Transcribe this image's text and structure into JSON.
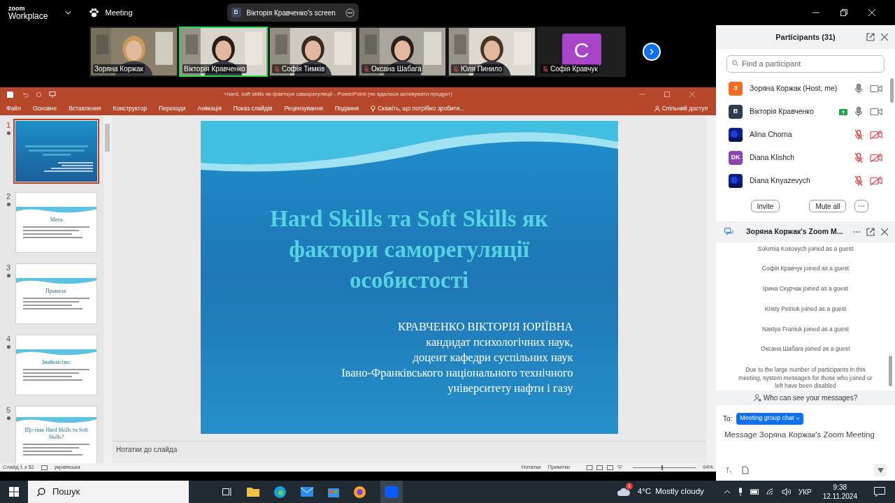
{
  "zoom_bar": {
    "logo_top": "zoom",
    "logo_bottom": "Workplace",
    "meeting": "Meeting",
    "screen_initial": "B",
    "screen_label": "Вікторія Кравченко's screen"
  },
  "videos": [
    {
      "kind": "video",
      "name": "Зоряна Коржак",
      "muted": false,
      "selected": false
    },
    {
      "kind": "video",
      "name": "Вікторія Кравченко",
      "muted": false,
      "selected": true
    },
    {
      "kind": "video",
      "name": "Софія Тимків",
      "muted": true,
      "selected": false
    },
    {
      "kind": "video",
      "name": "Оксана Шабага",
      "muted": true,
      "selected": false
    },
    {
      "kind": "video",
      "name": "Юля Пинило",
      "muted": true,
      "selected": false
    },
    {
      "kind": "avatar",
      "name": "Софія Кравчук",
      "muted": true,
      "selected": false,
      "initial": "C",
      "color": "#a845c9"
    }
  ],
  "powerpoint": {
    "title": "+hard, soft skills як фактори саморегуляції - PowerPoint (не вдалося активувати продукт)",
    "menu": [
      "Файл",
      "Основне",
      "Вставлення",
      "Конструктор",
      "Переходи",
      "Анімація",
      "Показ слайдів",
      "Рецензування",
      "Подання"
    ],
    "tell_me": "Скажіть, що потрібно зробити...",
    "share": "Спільний доступ",
    "thumbnails": [
      {
        "number": "1",
        "kind": "title",
        "selected": true
      },
      {
        "number": "2",
        "kind": "text",
        "selected": false,
        "heading": "Мета"
      },
      {
        "number": "3",
        "kind": "text",
        "selected": false,
        "heading": "Правила:"
      },
      {
        "number": "4",
        "kind": "text",
        "selected": false,
        "heading": "Знайомство:"
      },
      {
        "number": "5",
        "kind": "text",
        "selected": false,
        "heading": "Що таке Hard Skills та Soft Skills?"
      }
    ],
    "slide": {
      "title": "Hard Skills та Soft Skills як фактори саморегуляції особистості",
      "author_lines": [
        "КРАВЧЕНКО ВІКТОРІЯ ЮРІЇВНА",
        "кандидат психологічних наук,",
        "доцент кафедри суспільних наук",
        "Івано-Франківського національного технічного",
        "університету нафти і газу"
      ]
    },
    "notes": "Нотатки до слайда",
    "status": {
      "slide_count": "Слайд 1 з 52",
      "language": "українська",
      "notes_button": "Нотатки",
      "comments_button": "Примітки",
      "zoom": "94%",
      "level": 0.47
    }
  },
  "participants": {
    "title": "Participants (31)",
    "search_placeholder": "Find a participant",
    "people": [
      {
        "kind": "initial",
        "initial": "З",
        "color": "#f26d21",
        "name": "Зоряна Коржак (Host, me)",
        "muted": false,
        "video_off": false,
        "sharing": false
      },
      {
        "kind": "initial",
        "initial": "B",
        "color": "#2d3e50",
        "name": "Вікторія Кравченко",
        "muted": false,
        "video_off": false,
        "sharing": true
      },
      {
        "kind": "picture",
        "name": "Alina Chorna",
        "muted": true,
        "video_off": true,
        "sharing": false
      },
      {
        "kind": "initial",
        "initial": "DK",
        "color": "#8e44ad",
        "name": "Diana Klishch",
        "muted": true,
        "video_off": true,
        "sharing": false
      },
      {
        "kind": "picture",
        "name": "Diana Knyazevych",
        "muted": true,
        "video_off": true,
        "sharing": false
      }
    ],
    "buttons": [
      "Invite",
      "Mute all"
    ]
  },
  "chat": {
    "title": "Зоряна Коржак's Zoom M...",
    "messages": [
      "Solomia Kosovych joined as a guest",
      "Софія Кравчук joined as a guest",
      "Ірина Скурчак joined as a guest",
      "Kristy Petriuk joined as a guest",
      "Nastya Franiuk joined as a guest",
      "Оксана Шабага joined as a guest"
    ],
    "notice": "Due to the large number of participants in this meeting, system messages for those who joined or left have been disabled",
    "who_can_see": "Who can see your messages?",
    "to_label": "To:",
    "recipient": "Meeting group chat",
    "placeholder": "Message Зоряна Коржак's Zoom Meeting"
  },
  "taskbar": {
    "search": "Пошук",
    "weather_badge": "1",
    "temperature": "4°C",
    "weather": "Mostly cloudy",
    "language": "УКР",
    "time": "9:38",
    "date": "12.11.2024"
  }
}
